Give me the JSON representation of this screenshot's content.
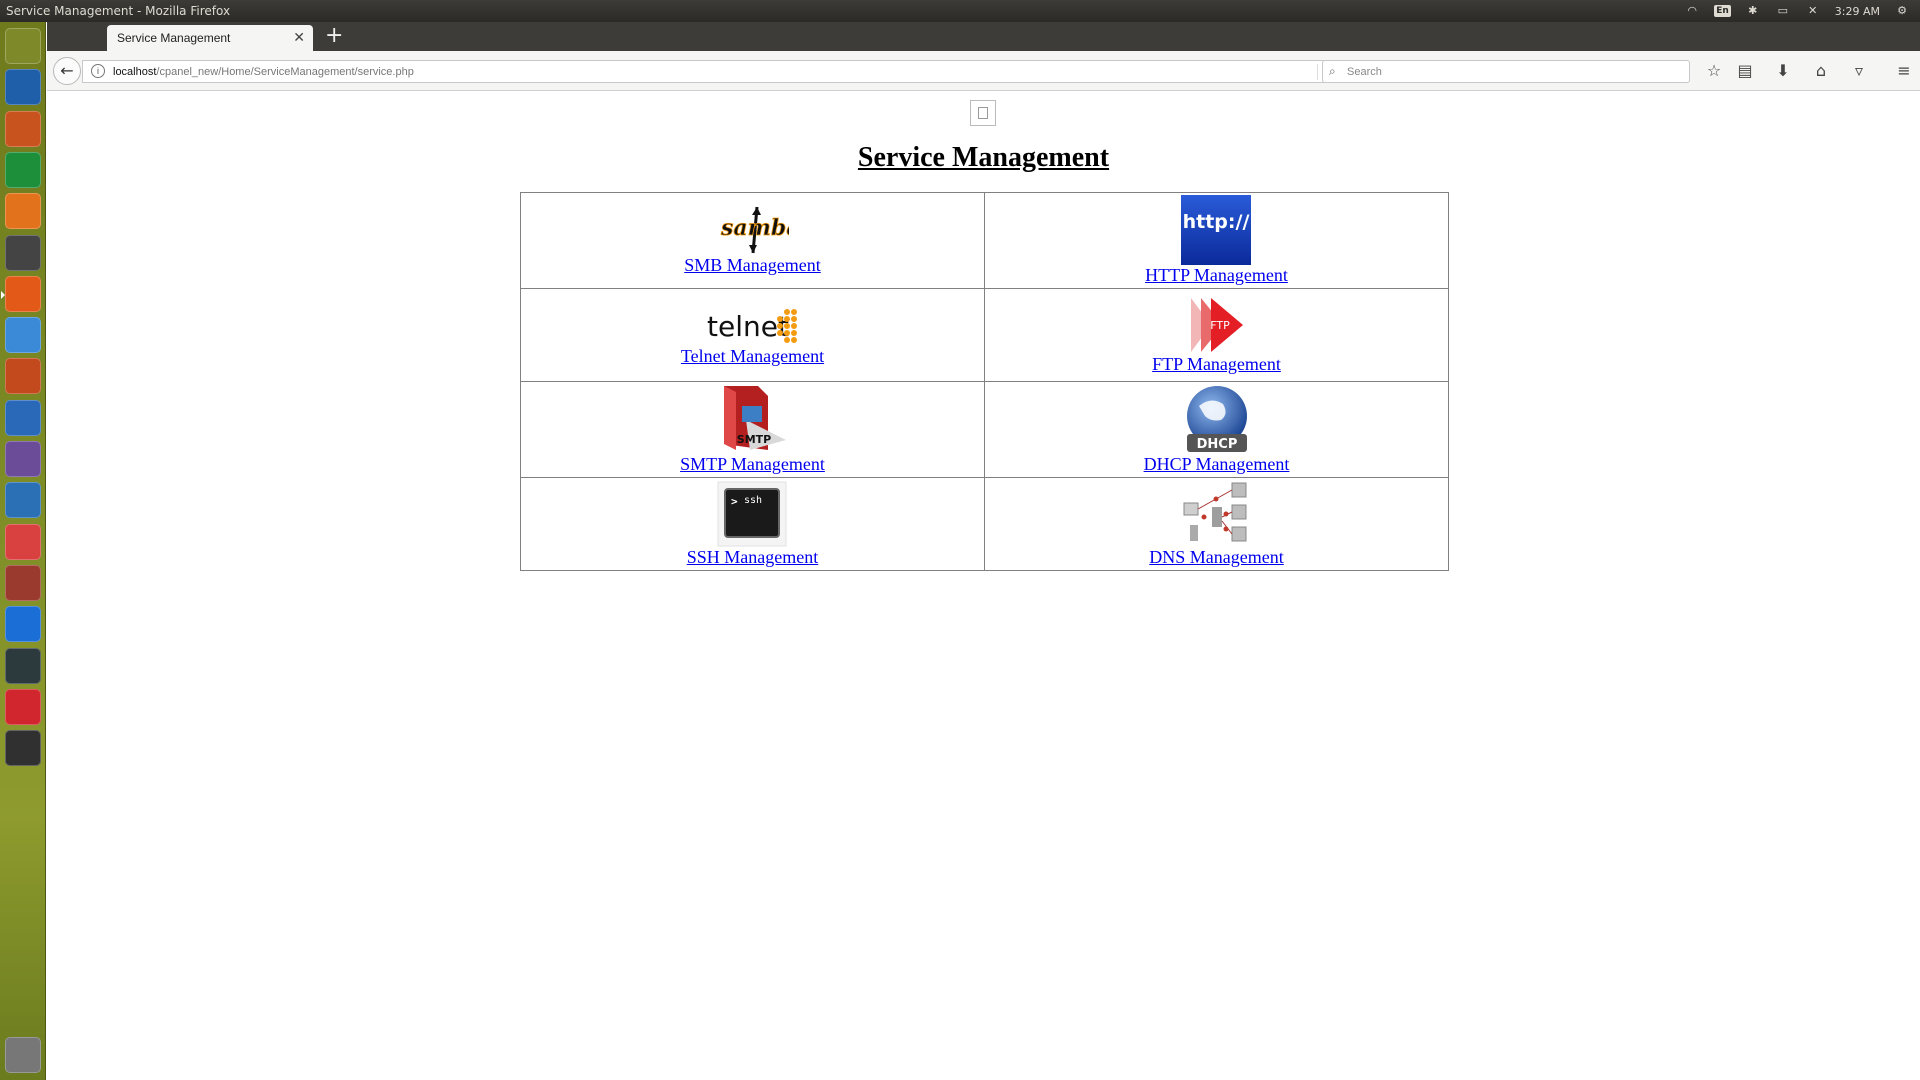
{
  "window": {
    "title": "Service Management - Mozilla Firefox"
  },
  "system_tray": {
    "language": "En",
    "time": "3:29 AM"
  },
  "launcher": {
    "items": [
      {
        "name": "dash-home-icon",
        "color": "#7e8a2a"
      },
      {
        "name": "libreoffice-writer-icon",
        "color": "#1f5ea8"
      },
      {
        "name": "libreoffice-impress-icon",
        "color": "#c9531e"
      },
      {
        "name": "libreoffice-calc-icon",
        "color": "#1d8f3b"
      },
      {
        "name": "ubuntu-software-icon",
        "color": "#e2731c"
      },
      {
        "name": "amazon-icon",
        "color": "#444444"
      },
      {
        "name": "firefox-icon",
        "color": "#e35a18"
      },
      {
        "name": "chrome-icon",
        "color": "#3b8ad8"
      },
      {
        "name": "system-settings-icon",
        "color": "#c24a1d"
      },
      {
        "name": "r-language-icon",
        "color": "#2a68b8"
      },
      {
        "name": "workspace-switcher-icon",
        "color": "#6b4c99"
      },
      {
        "name": "virtualbox-icon",
        "color": "#2b6fb5"
      },
      {
        "name": "text-editor-icon",
        "color": "#d94141"
      },
      {
        "name": "file-manager-icon",
        "color": "#9a3a2e"
      },
      {
        "name": "teamviewer-icon",
        "color": "#1b6ed6"
      },
      {
        "name": "system-monitor-icon",
        "color": "#2d3a3d"
      },
      {
        "name": "color-app-icon",
        "color": "#d1262e"
      },
      {
        "name": "terminal-icon",
        "color": "#303030"
      },
      {
        "name": "trash-icon",
        "color": "#777777"
      }
    ]
  },
  "browser": {
    "tab_title": "Service Management",
    "url_host": "localhost",
    "url_path": "/cpanel_new/Home/ServiceManagement/service.php",
    "search_placeholder": "Search"
  },
  "page": {
    "title": "Service Management",
    "services": [
      {
        "label": "SMB Management",
        "icon": "samba-logo-icon"
      },
      {
        "label": "HTTP Management",
        "icon": "http-icon"
      },
      {
        "label": "Telnet Management",
        "icon": "telnet-logo-icon"
      },
      {
        "label": "FTP Management",
        "icon": "ftp-icon"
      },
      {
        "label": "SMTP Management",
        "icon": "smtp-icon"
      },
      {
        "label": "DHCP Management",
        "icon": "dhcp-globe-icon"
      },
      {
        "label": "SSH Management",
        "icon": "ssh-terminal-icon"
      },
      {
        "label": "DNS Management",
        "icon": "dns-network-icon"
      }
    ],
    "icon_text": {
      "samba": "samba",
      "http": "http://",
      "telnet": "telnet",
      "ftp": "FTP",
      "smtp": "SMTP",
      "dhcp": "DHCP",
      "ssh": "ssh"
    }
  }
}
